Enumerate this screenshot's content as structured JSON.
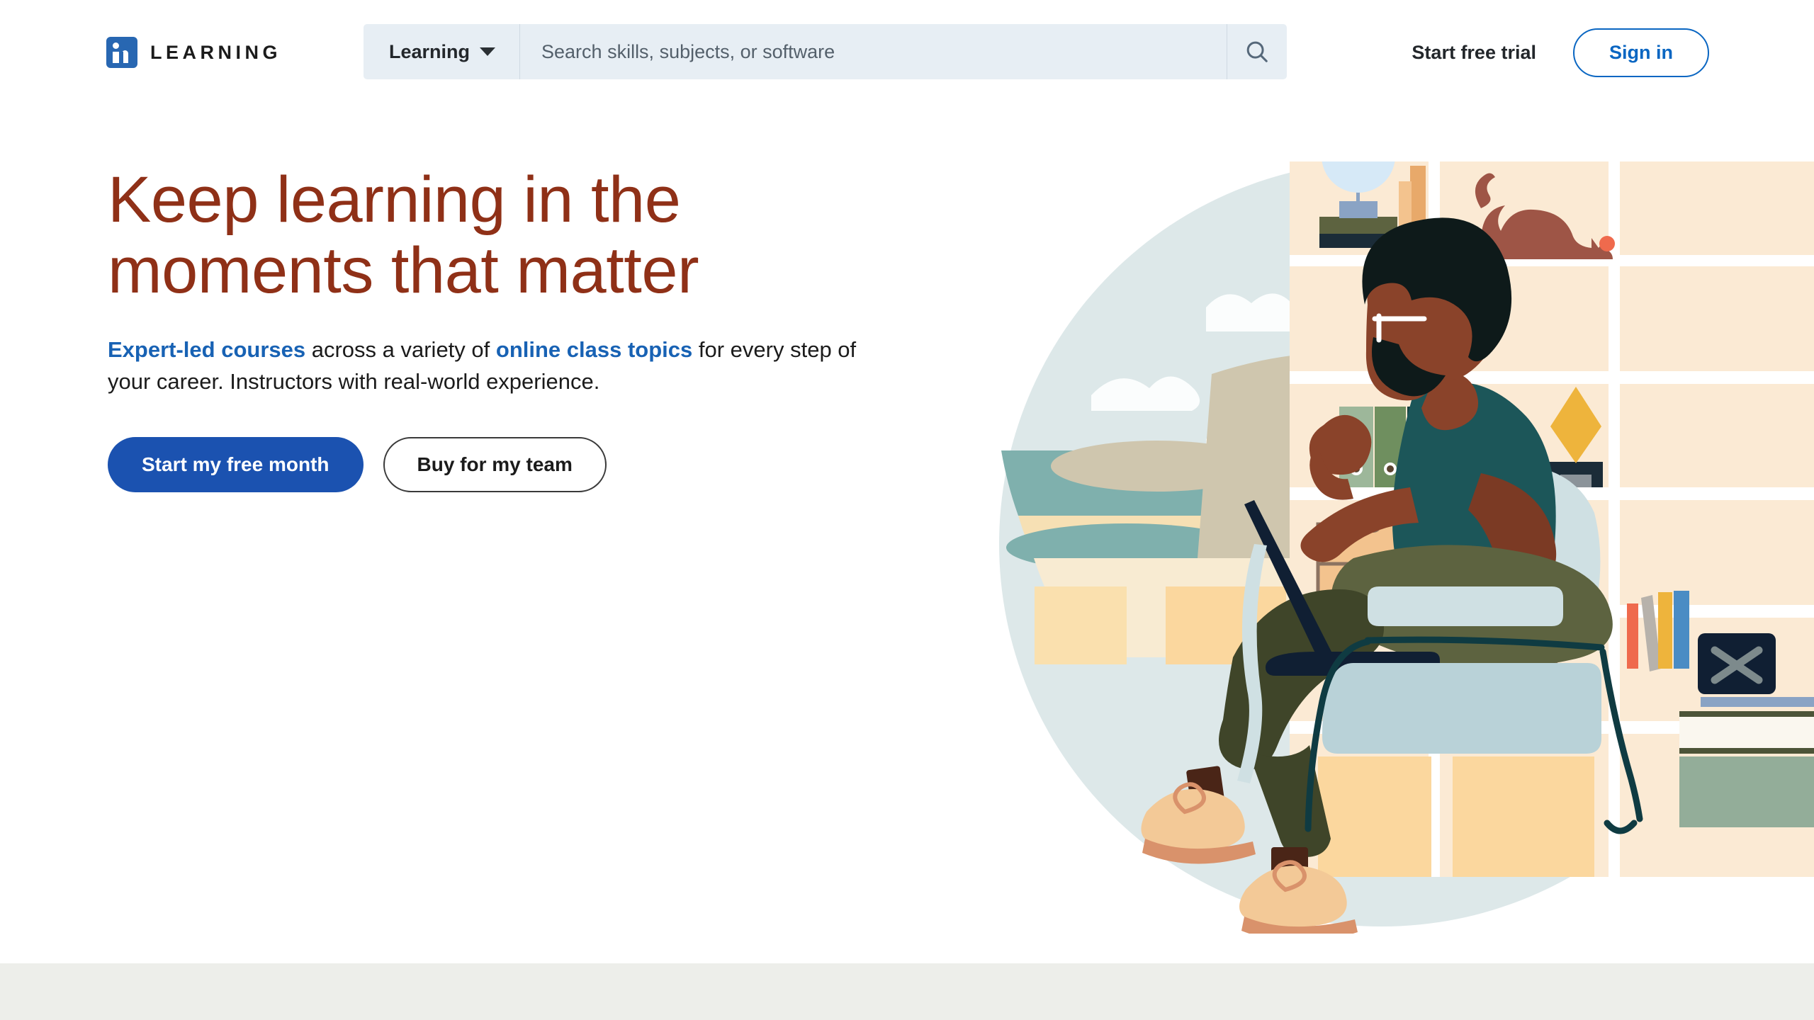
{
  "header": {
    "logo_icon": "linkedin-in-logo",
    "brand_word": "LEARNING",
    "search": {
      "scope_label": "Learning",
      "scope_caret_icon": "chevron-down-icon",
      "placeholder": "Search skills, subjects, or software",
      "value": "",
      "search_icon": "search-icon"
    },
    "start_free_trial": "Start free trial",
    "sign_in": "Sign in"
  },
  "hero": {
    "headline_line1": "Keep learning in the",
    "headline_line2": "moments that matter",
    "subhead": {
      "link1": "Expert-led courses",
      "mid": " across a variety of ",
      "link2": "online class topics",
      "tail": " for every step of your career. Instructors with real-world experience."
    },
    "cta_primary": "Start my free month",
    "cta_secondary": "Buy for my team"
  },
  "colors": {
    "headline_red": "#8f3017",
    "link_blue": "#1862b4",
    "brand_blue": "#0a66c2",
    "primary_button_blue": "#1b52b0",
    "search_bg": "#e7eef4",
    "bottom_band": "#edeeea",
    "sky": "#dde8e9",
    "shelf_cream": "#f8e9d2",
    "shelf_tan": "#f8d9ad",
    "chair_blue": "#cfe0e3",
    "chair_frame": "#0f3b42",
    "pants_olive": "#5d6340",
    "shirt_teal": "#1c5659",
    "skin": "#8a432a",
    "hair": "#0e1a1a",
    "cat_brown": "#9e5546",
    "lamp_red": "#e0401f",
    "vase_yellow": "#eeb43c"
  },
  "illustration": {
    "scene_name": "person-reading-laptop-in-armchair-with-bookshelf",
    "elements": [
      "sky-circle",
      "clouds",
      "sea",
      "beach",
      "bookshelf",
      "globe",
      "cat",
      "ball",
      "binders",
      "books",
      "vase",
      "lamp",
      "clocks",
      "drawers",
      "armchair",
      "laptop",
      "person",
      "shoes"
    ]
  }
}
